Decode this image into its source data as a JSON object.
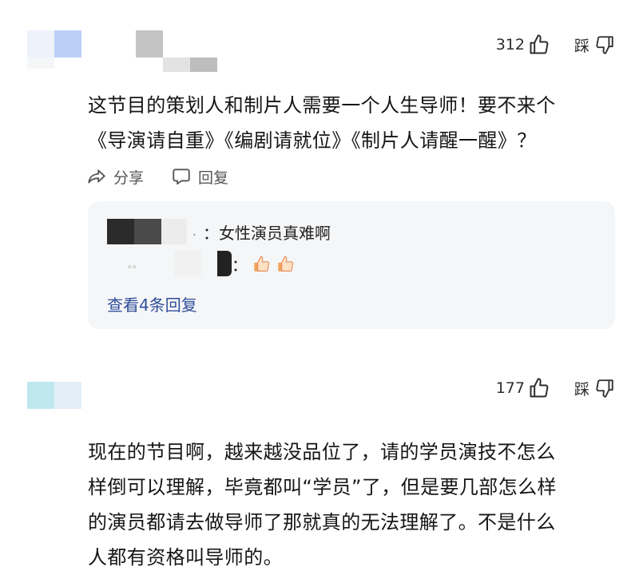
{
  "comments": [
    {
      "like_count": "312",
      "dislike_label": "踩",
      "text_line1": "这节目的策划人和制片人需要一个人生导师！要不来个",
      "text_line2": "《导演请自重》《编剧请就位》《制片人请醒一醒》？",
      "actions": {
        "share_label": "分享",
        "reply_label": "回复"
      },
      "replies": {
        "reply1_text": "：女性演员真难啊",
        "reply2_text": "：",
        "reply2_emoji": "thumbs-up-emoji x2",
        "reply1_punct": "．",
        "reply2_punct": "。。",
        "view_more": "查看4条回复"
      }
    },
    {
      "like_count": "177",
      "dislike_label": "踩",
      "text_lines": [
        "现在的节目啊，越来越没品位了，请的学员演技不怎么",
        "样倒可以理解，毕竟都叫“学员”了，但是要几部怎么样",
        "的演员都请去做导师了那就真的无法理解了。不是什么",
        "人都有资格叫导师的。"
      ]
    }
  ],
  "icons": {
    "like": "thumbs-up-outline-icon",
    "dislike": "thumbs-down-outline-icon",
    "share": "share-arrow-icon",
    "reply": "comment-bubble-icon"
  },
  "colors": {
    "link": "#2f4e9b",
    "reply_bg": "#f5f6f7",
    "text": "#161616",
    "muted": "#555555"
  }
}
